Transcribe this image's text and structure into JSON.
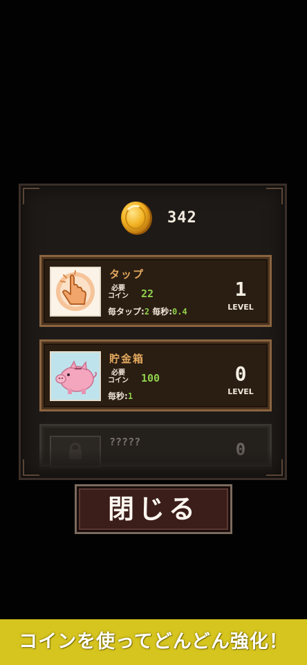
{
  "coins": {
    "icon": "gold-coin-icon",
    "value": "342"
  },
  "upgrades": [
    {
      "title": "タップ",
      "icon": "tap-hand-icon",
      "req_label_top": "必要",
      "req_label_bottom": "コイン",
      "req_value": "22",
      "stat_tap_label": "毎タップ:",
      "stat_tap_value": "2",
      "stat_sec_label": "毎秒:",
      "stat_sec_value": "0.4",
      "level": "1",
      "level_label": "LEVEL"
    },
    {
      "title": "貯金箱",
      "icon": "piggy-bank-icon",
      "req_label_top": "必要",
      "req_label_bottom": "コイン",
      "req_value": "100",
      "stat_sec_label": "毎秒:",
      "stat_sec_value": "1",
      "level": "0",
      "level_label": "LEVEL"
    },
    {
      "title": "?????",
      "icon": "locked-item-icon",
      "level": "0"
    }
  ],
  "close_button": "閉じる",
  "banner": "コインを使ってどんどん強化！",
  "colors": {
    "accent_gold": "#e3a95e",
    "value_green": "#8fd14c",
    "banner_yellow": "#d6c51f",
    "close_red": "#3b1d1a"
  }
}
